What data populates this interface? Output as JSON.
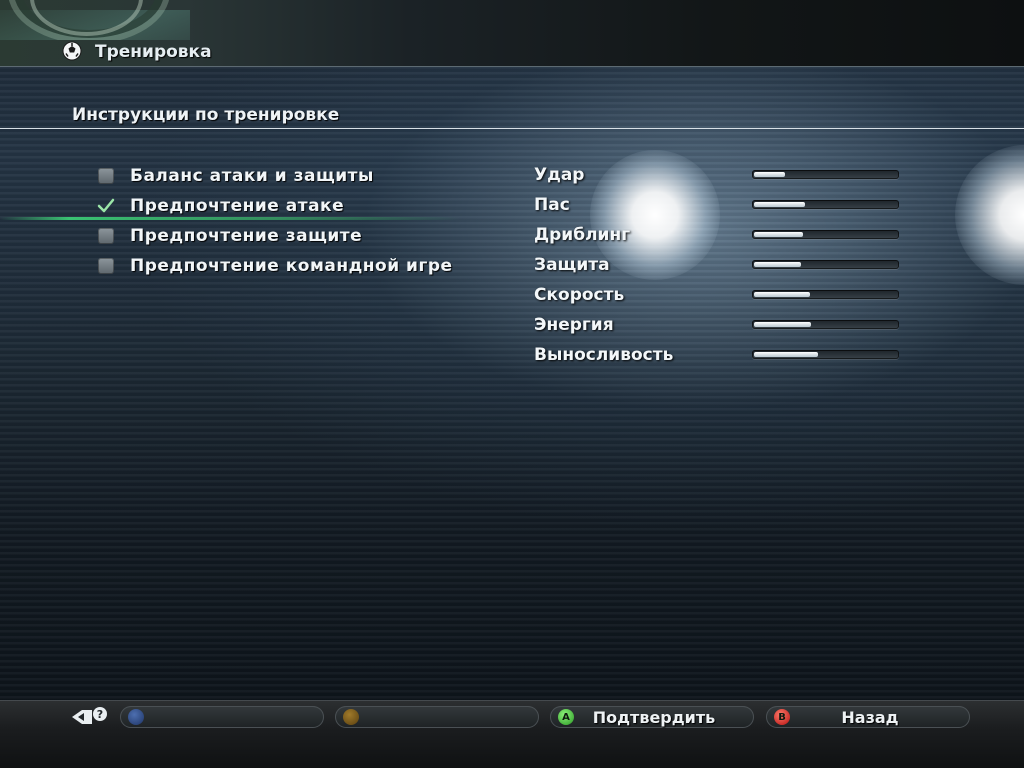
{
  "header": {
    "title": "Тренировка"
  },
  "section": {
    "title": "Инструкции по тренировке"
  },
  "options": [
    {
      "label": "Баланс атаки и защиты",
      "checked": false
    },
    {
      "label": "Предпочтение атаке",
      "checked": true
    },
    {
      "label": "Предпочтение защите",
      "checked": false
    },
    {
      "label": "Предпочтение командной игре",
      "checked": false
    }
  ],
  "selected_option_index": 1,
  "stats": [
    {
      "label": "Удар",
      "level": 0.22
    },
    {
      "label": "Пас",
      "level": 0.36
    },
    {
      "label": "Дриблинг",
      "level": 0.34
    },
    {
      "label": "Защита",
      "level": 0.33
    },
    {
      "label": "Скорость",
      "level": 0.39
    },
    {
      "label": "Энергия",
      "level": 0.4
    },
    {
      "label": "Выносливость",
      "level": 0.45
    }
  ],
  "footer": {
    "buttons": [
      {
        "label": "",
        "icon": "x-button-icon",
        "color": "#2c4a8a"
      },
      {
        "label": "",
        "icon": "y-button-icon",
        "color": "#7a5a1a"
      },
      {
        "label": "Подтвердить",
        "icon": "a-button-icon",
        "color": "#3fc43a"
      },
      {
        "label": "Назад",
        "icon": "b-button-icon",
        "color": "#e02020"
      }
    ]
  },
  "colors": {
    "selection_highlight": "#3cd278",
    "check_mark": "#9be6a8"
  }
}
